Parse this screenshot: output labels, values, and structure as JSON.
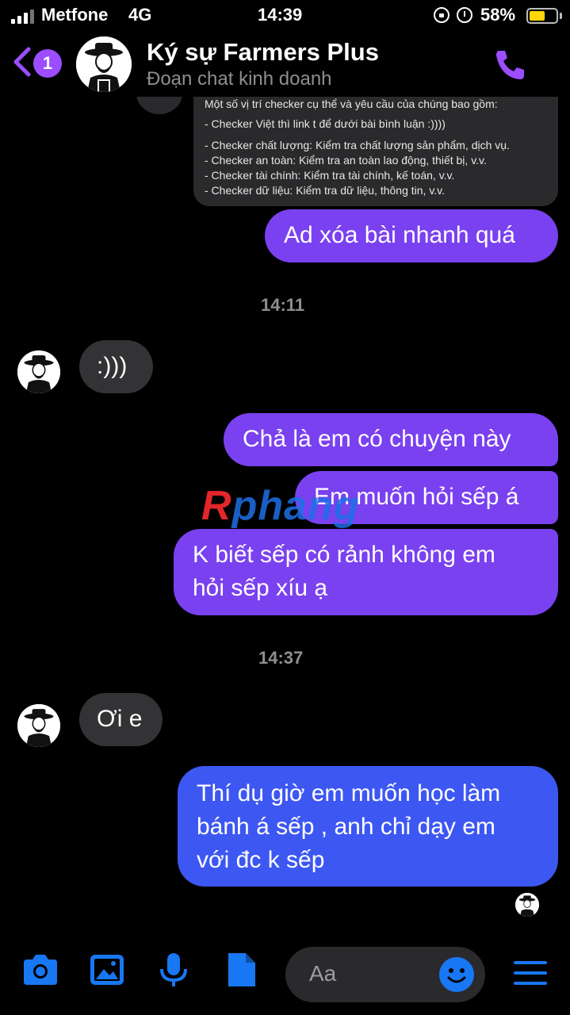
{
  "status_bar": {
    "carrier": "Metfone",
    "network": "4G",
    "time": "14:39",
    "battery_percent": "58%",
    "battery_level": 0.58,
    "battery_color": "#ffd60a"
  },
  "header": {
    "unread_count": "1",
    "contact_name": "Ký sự Farmers Plus",
    "subtitle": "Đoạn chat kinh doanh",
    "accent_color": "#9b4dff"
  },
  "shared_post": {
    "intro": "Một số vị trí checker cụ thể và yêu cầu của chúng bao gồm:",
    "line1": "- Checker Việt thì link t để dưới bài bình luận :))))",
    "line2": "- Checker chất lượng: Kiểm tra chất lượng sản phẩm, dịch vụ.",
    "line3": "- Checker an toàn: Kiểm tra an toàn lao động, thiết bị, v.v.",
    "line4": "- Checker tài chính: Kiểm tra tài chính, kế toán, v.v.",
    "line5": "- Checker dữ liệu: Kiểm tra dữ liệu, thông tin, v.v."
  },
  "messages": {
    "m1": "Ad xóa bài nhanh quá",
    "ts1": "14:11",
    "m2": ":)))",
    "m3": "Chả là em có chuyện này",
    "m4": "Em muốn hỏi sếp á",
    "m5_line1": "K biết sếp có rảnh không em",
    "m5_line2": "hỏi sếp xíu ạ",
    "ts2": "14:37",
    "m6": "Ơi e",
    "m7_line1": "Thí dụ giờ em muốn học làm",
    "m7_line2": "bánh á sếp , anh chỉ dạy em",
    "m7_line3": "với đc k sếp"
  },
  "watermark": {
    "first": "R",
    "rest": "phang"
  },
  "composer": {
    "placeholder": "Aa",
    "icons": [
      "camera-icon",
      "image-icon",
      "microphone-icon",
      "file-icon",
      "emoji-icon",
      "menu-icon"
    ],
    "icon_color": "#1877f2"
  },
  "colors": {
    "outgoing_bubble": "#7a41f0",
    "incoming_bubble": "#333336",
    "background": "#000000"
  }
}
